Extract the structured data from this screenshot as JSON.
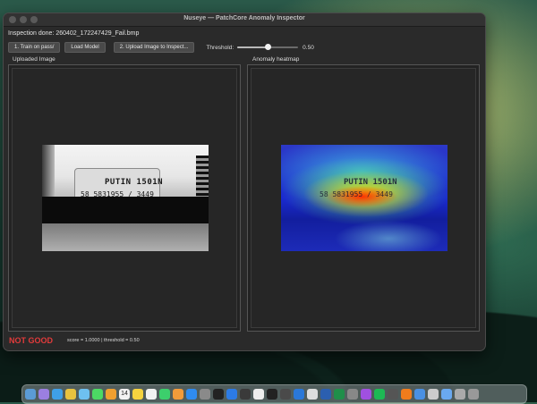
{
  "window": {
    "title": "Nuseye — PatchCore Anomaly Inspector"
  },
  "status": "Inspection done: 260402_172247429_Fail.bmp",
  "toolbar": {
    "train_label": "1. Train on pass/",
    "load_label": "Load Model",
    "upload_label": "2. Upload Image to Inspect...",
    "threshold_label": "Threshold:",
    "threshold_value": "0.50",
    "threshold_fraction": 0.5
  },
  "panels": {
    "uploaded_title": "Uploaded Image",
    "heatmap_title": "Anomaly heatmap"
  },
  "image_text": {
    "line1": "PUTIN 1501N",
    "line2": "58  5831955 / 3449"
  },
  "result": {
    "verdict": "NOT GOOD",
    "score_text": "score = 1.0000   |   threshold = 0.50"
  },
  "colors": {
    "verdict": "#e23b3b"
  },
  "dock": {
    "icons": [
      "finder-icon",
      "launchpad-icon",
      "safari-icon",
      "chrome-icon",
      "mail-icon",
      "messages-icon",
      "photos-icon",
      "calendar-icon",
      "notes-icon",
      "reminders-icon",
      "numbers-icon",
      "pages-icon",
      "app-store-icon",
      "settings-icon",
      "terminal-icon",
      "vscode-icon",
      "activity-icon",
      "8-icon",
      "github-icon",
      "sphere-icon",
      "xcode-icon",
      "tweaks-icon",
      "word-icon",
      "excel-icon",
      "font-icon",
      "podcast-icon",
      "spotify-icon",
      "app-icon",
      "vlc-icon",
      "preview-icon",
      "textedit-icon",
      "folder-icon",
      "download-icon",
      "trash-icon"
    ],
    "calendar_day": "14"
  }
}
